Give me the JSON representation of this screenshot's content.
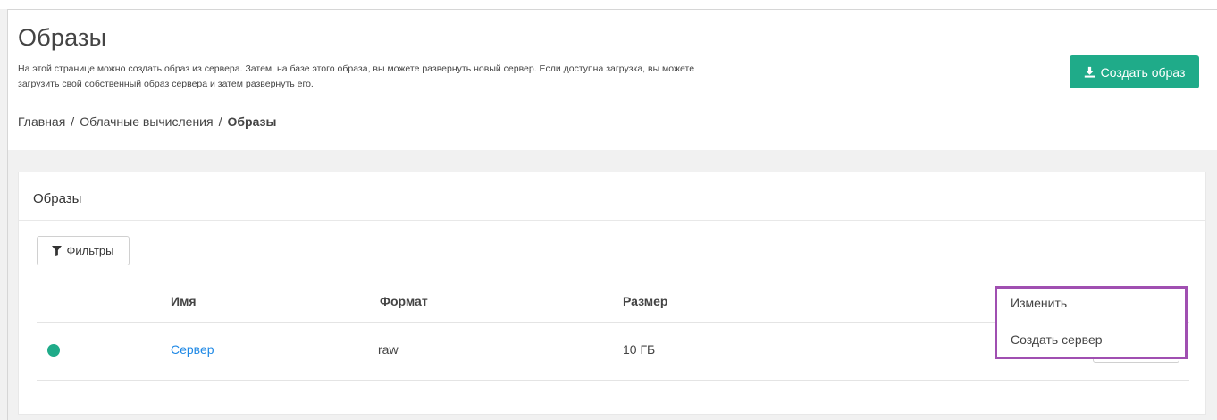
{
  "header": {
    "title": "Образы",
    "description": "На этой странице можно создать образ из сервера. Затем, на базе этого образа, вы можете развернуть новый сервер. Если доступна загрузка, вы можете загрузить свой собственный образ сервера и затем развернуть его.",
    "create_button_label": "Создать образ",
    "create_button_icon": "download-icon",
    "accent_color": "#1fab89"
  },
  "breadcrumb": {
    "items": [
      "Главная",
      "Облачные вычисления"
    ],
    "separator": "/",
    "current": "Образы"
  },
  "panel": {
    "title": "Образы",
    "filters_label": "Фильтры",
    "filters_icon": "filter-icon"
  },
  "table": {
    "columns": [
      "Имя",
      "Формат",
      "Размер"
    ],
    "rows": [
      {
        "status": "active",
        "status_color": "#1fab89",
        "name": "Сервер",
        "format": "raw",
        "size": "10 ГБ"
      }
    ]
  },
  "actions_menu": {
    "items": [
      "Изменить",
      "Создать сервер"
    ],
    "highlight_color": "#a04fb1"
  }
}
